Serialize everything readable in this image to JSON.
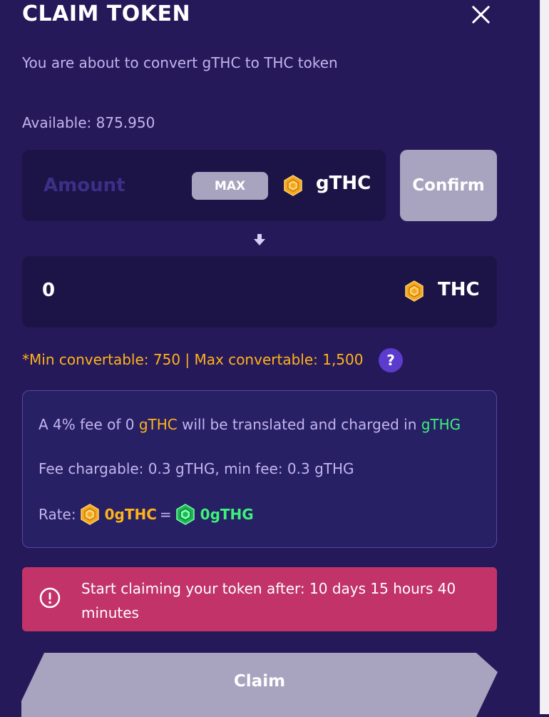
{
  "modal": {
    "title": "CLAIM TOKEN",
    "subtitle": "You are about to convert gTHC to THC token"
  },
  "balance": {
    "available_label": "Available: 875.950"
  },
  "convert": {
    "amount_placeholder": "Amount",
    "amount_value": "",
    "max_label": "MAX",
    "from_token": "gTHC",
    "confirm_label": "Confirm",
    "output_value": "0",
    "to_token": "THC"
  },
  "limits": {
    "text": "*Min convertable: 750 | Max convertable: 1,500",
    "help_label": "?"
  },
  "fee": {
    "line1_prefix": "A 4% fee of 0 ",
    "line1_token": "gTHC",
    "line1_middle": " will be translated and charged in ",
    "line1_charge_token": "gTHG",
    "line2": "Fee chargable: 0.3  gTHG, min fee: 0.3 gTHG",
    "rate_label": "Rate:",
    "rate_from": "0gTHC",
    "rate_eq": "=",
    "rate_to": "0gTHG"
  },
  "warning": {
    "text": "Start claiming your token after: 10 days 15 hours 40 minutes"
  },
  "actions": {
    "claim_label": "Claim"
  },
  "icons": {
    "close": "close-icon",
    "gthc": "gold-hexagon-coin-icon",
    "thc": "gold-hexagon-coin-icon",
    "gthg": "green-hexagon-coin-icon",
    "arrow": "arrow-down-icon",
    "help": "question-icon",
    "alert": "alert-circle-icon"
  },
  "colors": {
    "background": "#26195a",
    "accent_orange": "#ffb31a",
    "accent_green": "#3cf27a",
    "warning": "#c2336a",
    "disabled_button": "#a8a3bf"
  }
}
